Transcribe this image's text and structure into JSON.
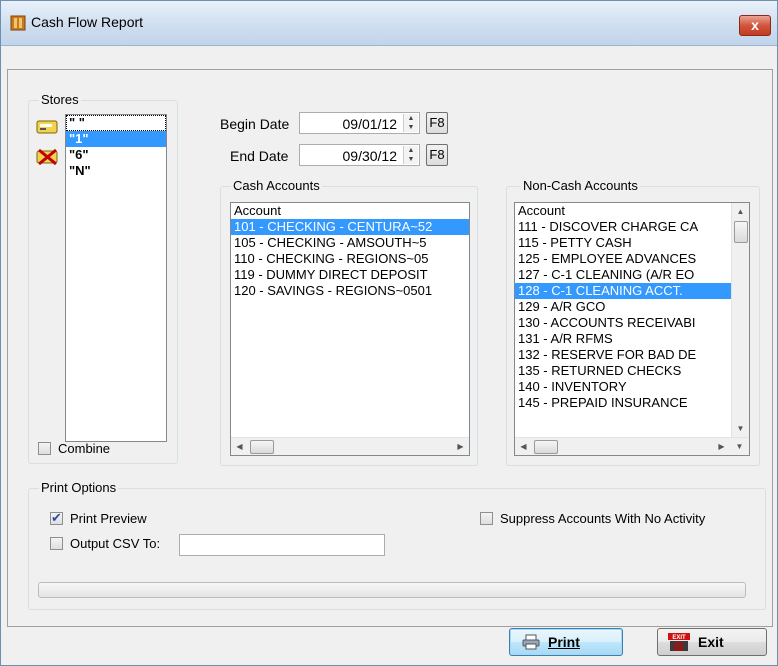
{
  "window": {
    "title": "Cash Flow Report",
    "close_glyph": "x"
  },
  "stores": {
    "group_label": "Stores",
    "items": [
      "\" \"",
      "\"1\"",
      "\"6\"",
      "\"N\""
    ],
    "selected_index": 1,
    "combine_label": "Combine",
    "combine_checked": false
  },
  "dates": {
    "begin_label": "Begin Date",
    "begin_value": "09/01/12",
    "end_label": "End Date",
    "end_value": "09/30/12",
    "f8_label": "F8"
  },
  "cash_accounts": {
    "group_label": "Cash Accounts",
    "column_header": "Account",
    "items": [
      "101 - CHECKING - CENTURA~52",
      "105 - CHECKING - AMSOUTH~5",
      "110 - CHECKING - REGIONS~05",
      "119 - DUMMY DIRECT DEPOSIT",
      "120 - SAVINGS - REGIONS~0501"
    ],
    "selected_index": 0
  },
  "noncash_accounts": {
    "group_label": "Non-Cash Accounts",
    "column_header": "Account",
    "items": [
      "111 - DISCOVER CHARGE CA",
      "115 - PETTY CASH",
      "125 - EMPLOYEE ADVANCES",
      "127 - C-1 CLEANING (A/R EO",
      "128 - C-1 CLEANING ACCT.",
      "129 - A/R GCO",
      "130 - ACCOUNTS RECEIVABI",
      "131 - A/R RFMS",
      "132 - RESERVE FOR BAD DE",
      "135 - RETURNED CHECKS",
      "140 - INVENTORY",
      "145 - PREPAID INSURANCE"
    ],
    "selected_index": 4
  },
  "print_options": {
    "group_label": "Print Options",
    "print_preview_label": "Print Preview",
    "print_preview_checked": true,
    "output_csv_label": "Output CSV To:",
    "output_csv_checked": false,
    "output_csv_value": "",
    "suppress_label": "Suppress Accounts With No Activity",
    "suppress_checked": false
  },
  "buttons": {
    "print_label": "Print",
    "exit_label": "Exit",
    "exit_icon_text": "EXIT"
  },
  "colors": {
    "selection": "#3399ff",
    "title_gradient_top": "#e9f1fa",
    "close_red": "#c33a21"
  }
}
